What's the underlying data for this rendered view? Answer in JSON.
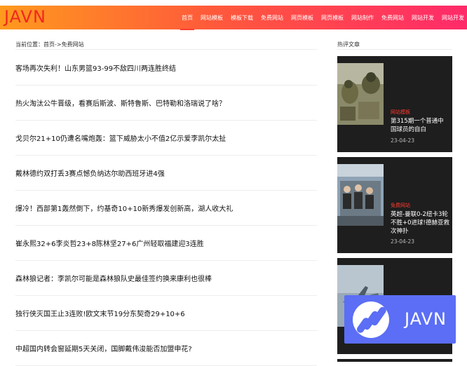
{
  "brand": {
    "logo_text": "JAVN"
  },
  "nav": {
    "items": [
      "首页",
      "网站模板",
      "模板下载",
      "免费网站",
      "网页模板",
      "网页模板",
      "网站制作",
      "免费网站",
      "网站开发",
      "网站开发"
    ],
    "active_index": 0
  },
  "breadcrumb": {
    "text": "当前位置：首页->免费网站"
  },
  "articles": [
    "客场再次失利！山东男篮93-99不敌四川两连胜终结",
    "热火淘汰公牛晋级，看赛后斯波、斯特鲁斯、巴特勒和洛瑞说了啥？",
    "戈贝尔21+10仍遭名嘴炮轰：篮下威胁太小不值2亿示爱李凯尔太扯",
    "戴林德约双打丢3赛点憾负纳达尔助西班牙进4强",
    "爆冷！西部第1轰然倒下，约基奇10+10新秀爆发创新高，湖人收大礼",
    "崔永熙32+6李炎哲23+8陈林坚27+6广州轻取福建迎3连胜",
    "森林狼记者：李凯尔可能是森林狼队史最佳签约换来康利也很棒",
    "独行侠灭国王止3连败!欧文末节19分东契奇29+10+6",
    "中超国内转会窗延期5天关闭，国脚戴伟浚能否加盟申花?"
  ],
  "sidebar": {
    "title": "热评文章",
    "cards": [
      {
        "category": "网站模板",
        "title": "第315期一个普通中国球员的自白",
        "date": "23-04-23"
      },
      {
        "category": "免费网站",
        "title": "英超-曼联0-2纽卡3轮不胜+0进球!德赫亚救次神扑",
        "date": "23-04-23"
      },
      {
        "category": "",
        "title": "",
        "date": ""
      }
    ]
  },
  "watermark": {
    "text": "JAVN"
  },
  "colors": {
    "accent": "#ff3b30",
    "header_start": "#ff9a1e",
    "header_end": "#ff2a6a",
    "card_bg": "#1e1e1e",
    "watermark_bg": "#5b6ef5"
  }
}
